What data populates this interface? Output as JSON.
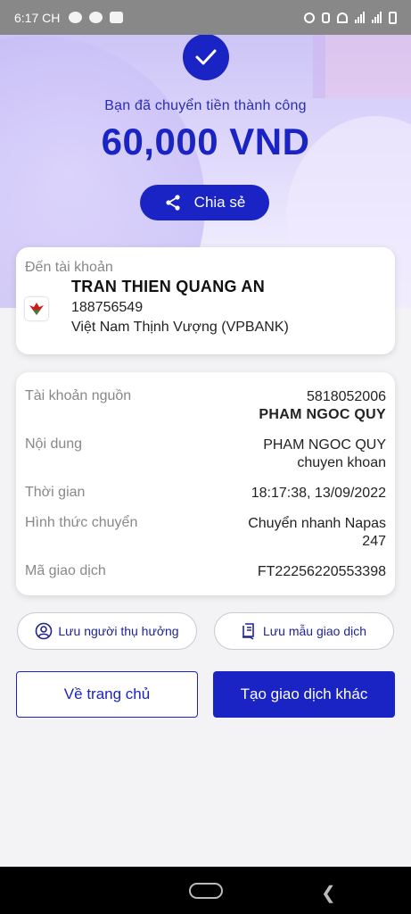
{
  "status_bar": {
    "time": "6:17 CH"
  },
  "success": {
    "message": "Bạn đã chuyển tiền thành công",
    "amount": "60,000 VND",
    "share_label": "Chia sẻ"
  },
  "destination": {
    "title": "Đến tài khoản",
    "name": "TRAN THIEN QUANG AN",
    "account": "188756549",
    "bank": "Việt Nam Thịnh Vượng (VPBANK)",
    "bank_logo_color": "#d0181f"
  },
  "details": {
    "source_label": "Tài khoản nguồn",
    "source_account": "5818052006",
    "source_name": "PHAM NGOC QUY",
    "content_label": "Nội dung",
    "content_line1": "PHAM NGOC QUY",
    "content_line2": "chuyen khoan",
    "time_label": "Thời gian",
    "time_value": "18:17:38, 13/09/2022",
    "method_label": "Hình thức chuyển",
    "method_line1": "Chuyển nhanh Napas",
    "method_line2": "247",
    "txn_label": "Mã giao dịch",
    "txn_value": "FT22256220553398"
  },
  "actions": {
    "save_beneficiary": "Lưu người thụ hưởng",
    "save_template": "Lưu mẫu giao dịch",
    "home": "Về trang chủ",
    "new_transaction": "Tạo giao dịch khác"
  },
  "colors": {
    "primary": "#1a23c4",
    "accent_text": "#2a2fb0"
  }
}
